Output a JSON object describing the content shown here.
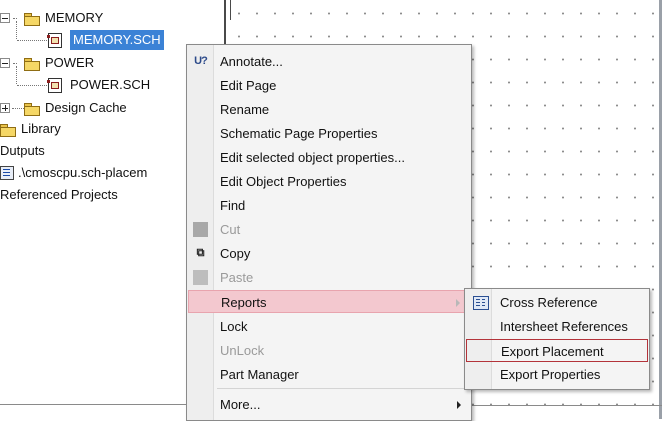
{
  "tree": {
    "memory_folder": "MEMORY",
    "memory_sch": "MEMORY.SCH",
    "power_folder": "POWER",
    "power_sch": "POWER.SCH",
    "design_cache": "Design Cache",
    "library": "Library",
    "outputs": "Dutputs",
    "placement_file": ".\\cmoscpu.sch-placem",
    "referenced_projects": "Referenced Projects"
  },
  "context_menu": {
    "items": [
      {
        "label": "Annotate...",
        "icon": "annotate-icon"
      },
      {
        "label": "Edit Page"
      },
      {
        "label": "Rename"
      },
      {
        "label": "Schematic Page Properties"
      },
      {
        "label": "Edit selected object properties..."
      },
      {
        "label": "Edit Object Properties"
      },
      {
        "label": "Find"
      },
      {
        "label": "Cut",
        "disabled": true,
        "icon": "cut-icon"
      },
      {
        "label": "Copy",
        "icon": "copy-icon"
      },
      {
        "label": "Paste",
        "disabled": true,
        "icon": "paste-icon"
      },
      {
        "label": "Reports",
        "highlighted": true,
        "submenu": true
      },
      {
        "label": "Lock"
      },
      {
        "label": "UnLock",
        "disabled": true
      },
      {
        "label": "Part Manager"
      },
      {
        "label": "More...",
        "submenu": true
      }
    ]
  },
  "reports_submenu": {
    "items": [
      {
        "label": "Cross Reference",
        "icon": "cross-reference-icon"
      },
      {
        "label": "Intersheet References"
      },
      {
        "label": "Export Placement",
        "outlined": true
      },
      {
        "label": "Export Properties"
      }
    ]
  },
  "colors": {
    "selection": "#3b82d6",
    "menu_highlight": "#f3c8cf",
    "outline": "#b3333a"
  }
}
